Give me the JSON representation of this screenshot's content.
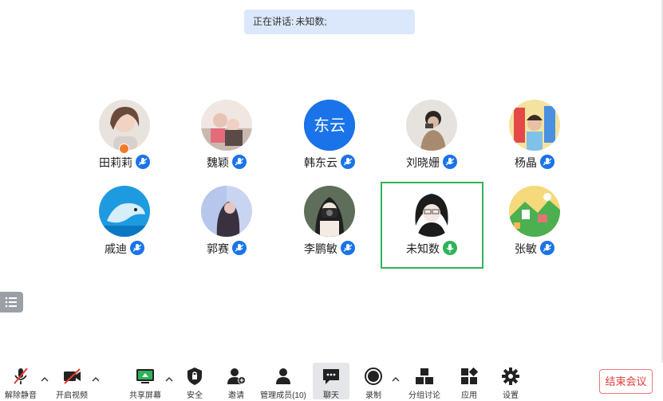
{
  "speaker_banner": {
    "prefix": "正在讲话:",
    "name": "未知数;"
  },
  "participants": [
    {
      "name": "田莉莉"
    },
    {
      "name": "魏颖"
    },
    {
      "name": "韩东云",
      "avatar_text": "东云"
    },
    {
      "name": "刘晓姗"
    },
    {
      "name": "杨晶"
    },
    {
      "name": "戚迪"
    },
    {
      "name": "郭赛"
    },
    {
      "name": "李鹏敏"
    },
    {
      "name": "未知数"
    },
    {
      "name": "张敏"
    }
  ],
  "toolbar": {
    "unmute": "解除静音",
    "start_video": "开启视频",
    "share_screen": "共享屏幕",
    "security": "安全",
    "invite": "邀请",
    "manage_members": "管理成员(10)",
    "chat": "聊天",
    "record": "录制",
    "breakout": "分组讨论",
    "apps": "应用",
    "settings": "设置"
  },
  "end_meeting": "结束会议",
  "colors": {
    "accent_blue": "#1a73e8",
    "active_speaker_green": "#2eb35a",
    "end_red": "#e53935",
    "banner_bg": "#dbe8fb"
  }
}
